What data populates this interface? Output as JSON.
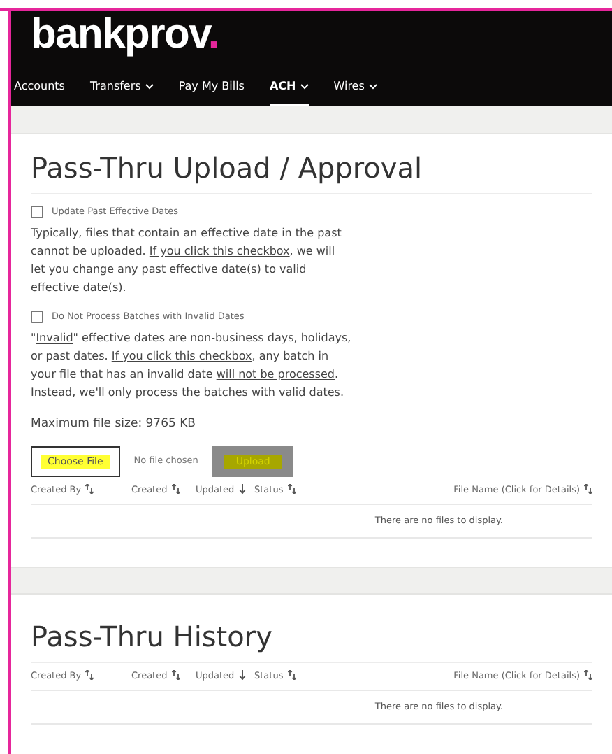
{
  "logo": {
    "text": "bankprov",
    "dot": "."
  },
  "nav": [
    {
      "label": "Accounts",
      "dropdown": false,
      "selected": false
    },
    {
      "label": "Transfers",
      "dropdown": true,
      "selected": false
    },
    {
      "label": "Pay My Bills",
      "dropdown": false,
      "selected": false
    },
    {
      "label": "ACH",
      "dropdown": true,
      "selected": true
    },
    {
      "label": "Wires",
      "dropdown": true,
      "selected": false
    }
  ],
  "upload": {
    "title": "Pass-Thru Upload / Approval",
    "options": [
      {
        "label": "Update Past Effective Dates",
        "checked": false,
        "description": [
          {
            "kind": "text",
            "text": "Typically, files that contain an effective date in the past cannot be uploaded. "
          },
          {
            "kind": "link",
            "text": "If you click this checkbox"
          },
          {
            "kind": "text",
            "text": ", we will let you change any past effective date(s) to valid effective date(s)."
          }
        ]
      },
      {
        "label": "Do Not Process Batches with Invalid Dates",
        "checked": false,
        "description": [
          {
            "kind": "text",
            "text": "\""
          },
          {
            "kind": "link",
            "text": "Invalid"
          },
          {
            "kind": "text",
            "text": "\" effective dates are non-business days, holidays, or past dates. "
          },
          {
            "kind": "link",
            "text": "If you click this checkbox"
          },
          {
            "kind": "text",
            "text": ", any batch in your file that has an invalid date "
          },
          {
            "kind": "link",
            "text": "will not be processed"
          },
          {
            "kind": "text",
            "text": ". Instead, we'll only process the batches with valid dates."
          }
        ]
      }
    ],
    "max_size": "Maximum file size: 9765 KB",
    "choose_button": "Choose File",
    "no_file": "No file chosen",
    "upload_button": "Upload",
    "upload_disabled": true,
    "columns": [
      {
        "label": "Created By",
        "kind": "sortable"
      },
      {
        "label": "Created",
        "kind": "sortable"
      },
      {
        "label": "Updated",
        "kind": "sorted_down"
      },
      {
        "label": "Status",
        "kind": "sortable"
      },
      {
        "label": "File Name (Click for Details)",
        "kind": "sortable"
      }
    ],
    "empty": "There are no files to display."
  },
  "history": {
    "title": "Pass-Thru History",
    "columns": [
      {
        "label": "Created By",
        "kind": "sortable"
      },
      {
        "label": "Created",
        "kind": "sortable"
      },
      {
        "label": "Updated",
        "kind": "sorted_down"
      },
      {
        "label": "Status",
        "kind": "sortable"
      },
      {
        "label": "File Name (Click for Details)",
        "kind": "sortable"
      }
    ],
    "empty": "There are no files to display."
  }
}
